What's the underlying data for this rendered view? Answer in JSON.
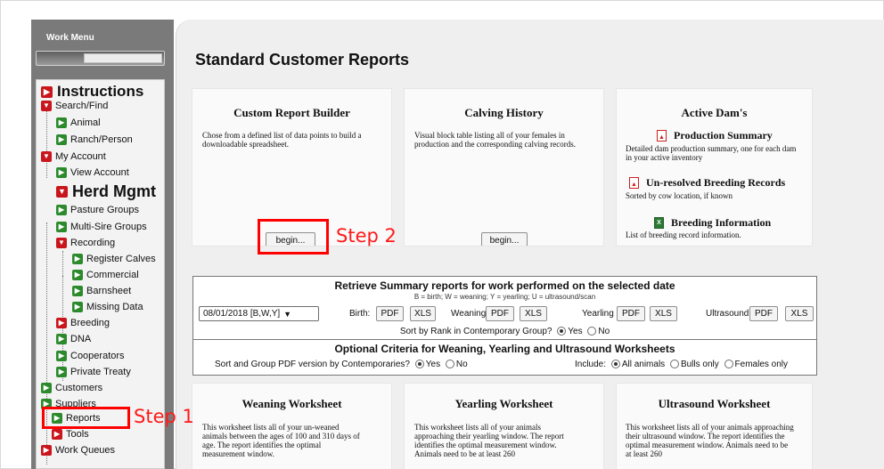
{
  "sidebar": {
    "title": "Work Menu",
    "items": [
      {
        "label": "Instructions",
        "icon": "red-expand-icon"
      },
      {
        "label": "Search/Find",
        "icon": "red-expand-icon"
      },
      {
        "label": "Animal",
        "icon": "green-item-icon"
      },
      {
        "label": "Ranch/Person",
        "icon": "green-item-icon"
      },
      {
        "label": "My Account",
        "icon": "red-expand-icon"
      },
      {
        "label": "View Account",
        "icon": "green-item-icon"
      },
      {
        "label": "Herd Mgmt",
        "icon": "red-expand-icon"
      },
      {
        "label": "Pasture Groups",
        "icon": "green-item-icon"
      },
      {
        "label": "Multi-Sire Groups",
        "icon": "green-item-icon"
      },
      {
        "label": "Recording",
        "icon": "red-expand-icon"
      },
      {
        "label": "Register Calves",
        "icon": "green-item-icon"
      },
      {
        "label": "Commercial",
        "icon": "green-item-icon"
      },
      {
        "label": "Barnsheet",
        "icon": "green-item-icon"
      },
      {
        "label": "Missing Data",
        "icon": "green-item-icon"
      },
      {
        "label": "Breeding",
        "icon": "red-expand-icon"
      },
      {
        "label": "DNA",
        "icon": "green-item-icon"
      },
      {
        "label": "Cooperators",
        "icon": "green-item-icon"
      },
      {
        "label": "Private Treaty",
        "icon": "green-item-icon"
      },
      {
        "label": "Customers",
        "icon": "green-item-icon"
      },
      {
        "label": "Suppliers",
        "icon": "green-item-icon"
      },
      {
        "label": "Reports",
        "icon": "green-item-icon"
      },
      {
        "label": "Tools",
        "icon": "red-expand-icon"
      },
      {
        "label": "Work Queues",
        "icon": "red-expand-icon"
      }
    ]
  },
  "main": {
    "title": "Standard Customer Reports",
    "cards": {
      "custom": {
        "title": "Custom Report Builder",
        "desc": "Chose from a defined list of data points to build a downloadable spreadsheet.",
        "button": "begin..."
      },
      "calving": {
        "title": "Calving History",
        "desc": "Visual block table listing all of your females in production and the corresponding calving records.",
        "button": "begin..."
      },
      "dams": {
        "title": "Active Dam's",
        "links": [
          {
            "title": "Production Summary",
            "desc": "Detailed dam production summary, one for each dam in your active inventory",
            "icon": "pdf-icon"
          },
          {
            "title": "Un-resolved Breeding Records",
            "desc": "Sorted by cow location, if known",
            "icon": "pdf-icon"
          },
          {
            "title": "Breeding Information",
            "desc": "List of breeding record information.",
            "icon": "excel-icon"
          }
        ]
      },
      "weaning": {
        "title": "Weaning Worksheet",
        "desc": "This worksheet lists all of your un-weaned animals between the ages of 100 and 310 days of age. The report identifies the optimal measurement window."
      },
      "yearling": {
        "title": "Yearling Worksheet",
        "desc": "This worksheet lists all of your animals approaching their yearling window. The report identifies the optimal measurement window. Animals need to be at least 260"
      },
      "ultrasound": {
        "title": "Ultrasound Worksheet",
        "desc": "This worksheet lists all of your animals approaching their ultrasound window. The report identifies the optimal measurement window. Animals need to be at least 260"
      }
    },
    "summary": {
      "heading": "Retrieve Summary reports for work performed on the selected date",
      "legend": "B = birth; W = weaning; Y = yearling; U = ultrasound/scan",
      "date_value": "08/01/2018 [B,W,Y]",
      "birth_label": "Birth:",
      "weaning_label": "Weaning",
      "yearling_label": "Yearling",
      "ultrasound_label": "Ultrasound",
      "pdf": "PDF",
      "xls": "XLS",
      "sort_rank": "Sort by Rank in Contemporary Group?",
      "yes": "Yes",
      "no": "No",
      "optional_heading": "Optional Criteria for Weaning, Yearling and Ultrasound Worksheets",
      "sort_group": "Sort and Group PDF version by Contemporaries?",
      "include": "Include:",
      "all_animals": "All animals",
      "bulls_only": "Bulls only",
      "females_only": "Females only"
    }
  },
  "annotations": {
    "step1": "Step 1",
    "step2": "Step 2",
    "color": "#ff0000"
  }
}
